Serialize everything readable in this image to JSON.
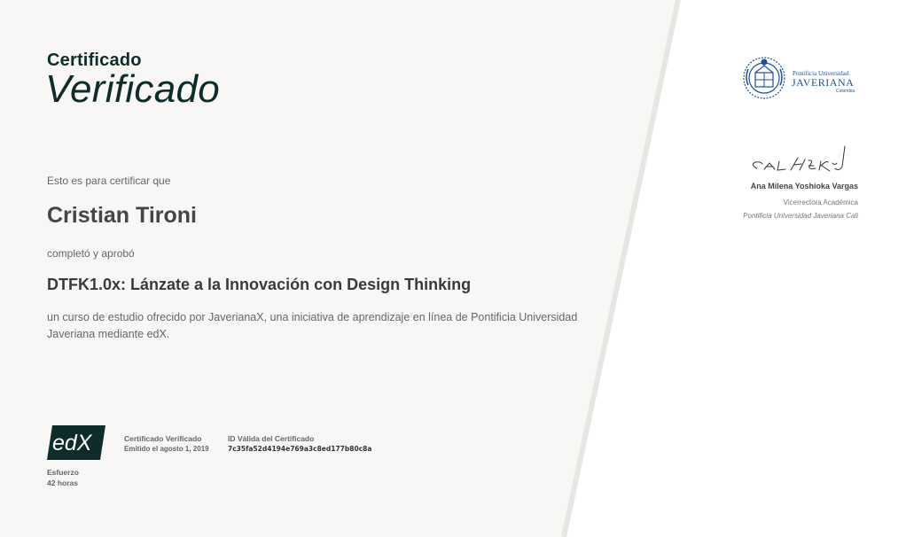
{
  "certificate": {
    "heading_small": "Certificado",
    "heading_large": "Verificado",
    "intro": "Esto es para certificar que",
    "learner_name": "Cristian Tironi",
    "completed_text": "completó y aprobó",
    "course_title": "DTFK1.0x: Lánzate a la Innovación con Design Thinking",
    "course_description": "un curso de estudio ofrecido por JaverianaX, una iniciativa de aprendizaje en línea de Pontificia Universidad Javeriana mediante edX."
  },
  "footer": {
    "logo_text": "edX",
    "effort_label": "Esfuerzo",
    "effort_value": "42 horas",
    "certificate_label": "Certificado Verificado",
    "issued_date": "Emitido el agosto 1, 2019",
    "id_label": "ID Válida del Certificado",
    "id_value": "7c35fa52d4194e769a3c8ed177b80c8a"
  },
  "university": {
    "logo_line1": "Pontificia Universidad",
    "logo_line2": "JAVERIANA",
    "logo_line3": "Colombia",
    "logo_icon": "crest-icon"
  },
  "signatory": {
    "name": "Ana Milena Yoshioka Vargas",
    "title": "Vicerrectora Académica",
    "organization": "Pontificia Universidad Javeriana Cali"
  },
  "colors": {
    "panel": "#f8f7f5",
    "heading": "#0d2c2a",
    "edx_logo": "#0d2c2a",
    "university_blue": "#1f4e96"
  }
}
